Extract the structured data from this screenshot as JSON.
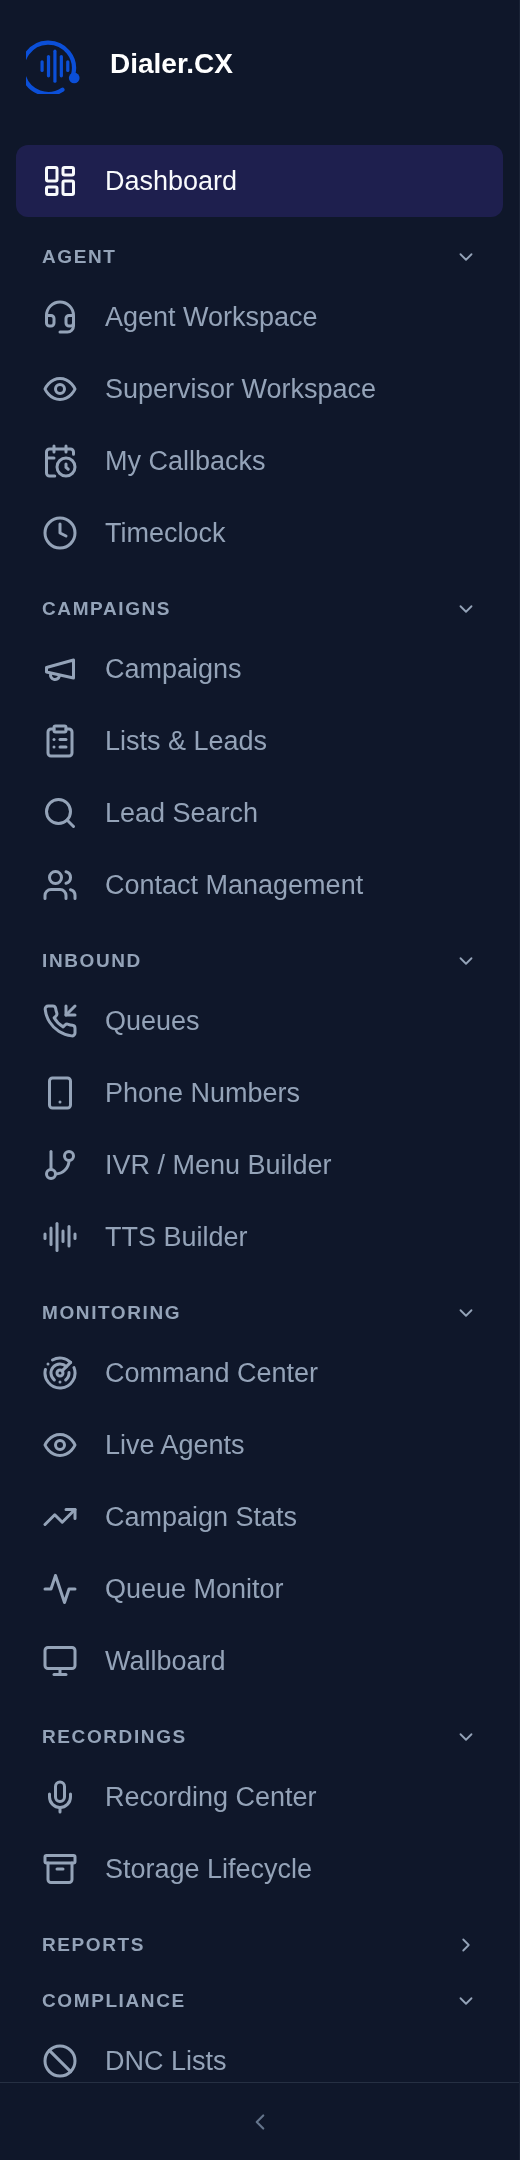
{
  "brand": {
    "name": "Dialer.CX"
  },
  "dashboard": {
    "label": "Dashboard",
    "selected": true
  },
  "sections": [
    {
      "title": "AGENT",
      "expanded": true,
      "items": [
        {
          "label": "Agent Workspace",
          "selected": false
        },
        {
          "label": "Supervisor Workspace",
          "selected": false
        },
        {
          "label": "My Callbacks",
          "selected": false
        },
        {
          "label": "Timeclock",
          "selected": false
        }
      ]
    },
    {
      "title": "CAMPAIGNS",
      "expanded": true,
      "items": [
        {
          "label": "Campaigns",
          "selected": false
        },
        {
          "label": "Lists & Leads",
          "selected": false
        },
        {
          "label": "Lead Search",
          "selected": false
        },
        {
          "label": "Contact Management",
          "selected": false
        }
      ]
    },
    {
      "title": "INBOUND",
      "expanded": true,
      "items": [
        {
          "label": "Queues",
          "selected": false
        },
        {
          "label": "Phone Numbers",
          "selected": false
        },
        {
          "label": "IVR / Menu Builder",
          "selected": false
        },
        {
          "label": "TTS Builder",
          "selected": false
        }
      ]
    },
    {
      "title": "MONITORING",
      "expanded": true,
      "items": [
        {
          "label": "Command Center",
          "selected": false
        },
        {
          "label": "Live Agents",
          "selected": false
        },
        {
          "label": "Campaign Stats",
          "selected": false
        },
        {
          "label": "Queue Monitor",
          "selected": false
        },
        {
          "label": "Wallboard",
          "selected": false
        }
      ]
    },
    {
      "title": "RECORDINGS",
      "expanded": true,
      "items": [
        {
          "label": "Recording Center",
          "selected": false
        },
        {
          "label": "Storage Lifecycle",
          "selected": false
        }
      ]
    },
    {
      "title": "REPORTS",
      "expanded": false
    },
    {
      "title": "COMPLIANCE",
      "expanded": true,
      "items": [
        {
          "label": "DNC Lists",
          "selected": false
        }
      ]
    }
  ]
}
